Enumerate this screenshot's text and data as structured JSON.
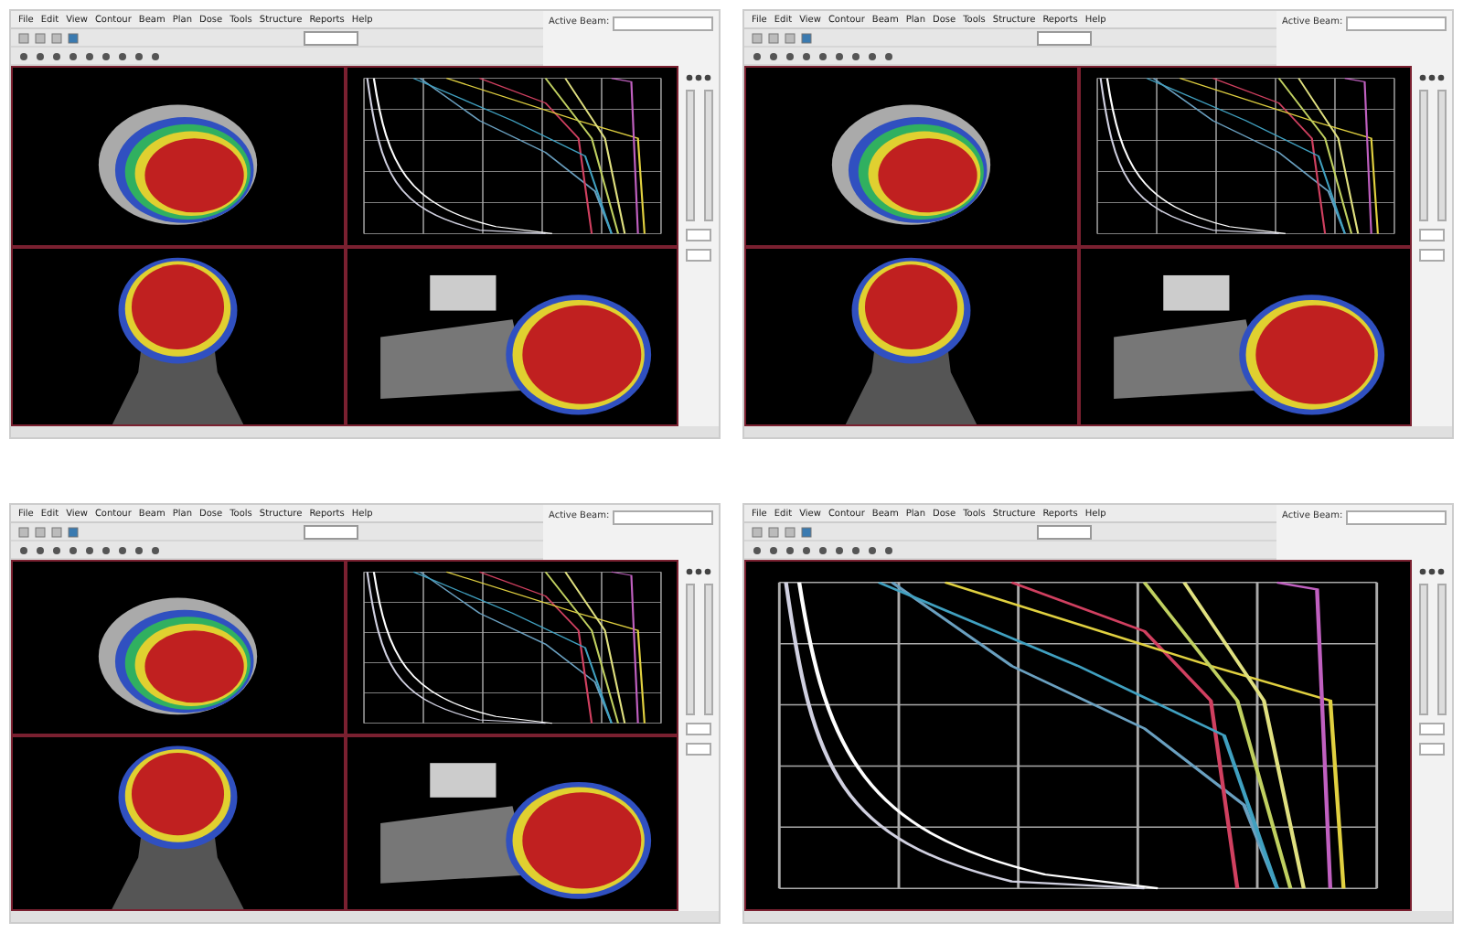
{
  "windows": [
    {
      "kind": "quad",
      "menu": [
        "File",
        "Edit",
        "View",
        "Contour",
        "Beam",
        "Plan",
        "Dose",
        "Tools",
        "Structure",
        "Reports",
        "Help"
      ],
      "active_beam_label": "Active Beam:",
      "views": [
        {
          "kind": "axial"
        },
        {
          "kind": "dvh"
        },
        {
          "kind": "coronal"
        },
        {
          "kind": "sagittal"
        }
      ]
    },
    {
      "kind": "quad",
      "menu": [
        "File",
        "Edit",
        "View",
        "Contour",
        "Beam",
        "Plan",
        "Dose",
        "Tools",
        "Structure",
        "Reports",
        "Help"
      ],
      "active_beam_label": "Active Beam:",
      "views": [
        {
          "kind": "axial"
        },
        {
          "kind": "dvh"
        },
        {
          "kind": "coronal"
        },
        {
          "kind": "sagittal"
        }
      ]
    },
    {
      "kind": "quad",
      "menu": [
        "File",
        "Edit",
        "View",
        "Contour",
        "Beam",
        "Plan",
        "Dose",
        "Tools",
        "Structure",
        "Reports",
        "Help"
      ],
      "active_beam_label": "Active Beam:",
      "views": [
        {
          "kind": "axial"
        },
        {
          "kind": "dvh"
        },
        {
          "kind": "coronal"
        },
        {
          "kind": "sagittal"
        }
      ]
    },
    {
      "kind": "single",
      "menu": [
        "File",
        "Edit",
        "View",
        "Contour",
        "Beam",
        "Plan",
        "Dose",
        "Tools",
        "Structure",
        "Reports",
        "Help"
      ],
      "active_beam_label": "Active Beam:",
      "views": [
        {
          "kind": "dvh"
        }
      ]
    }
  ]
}
